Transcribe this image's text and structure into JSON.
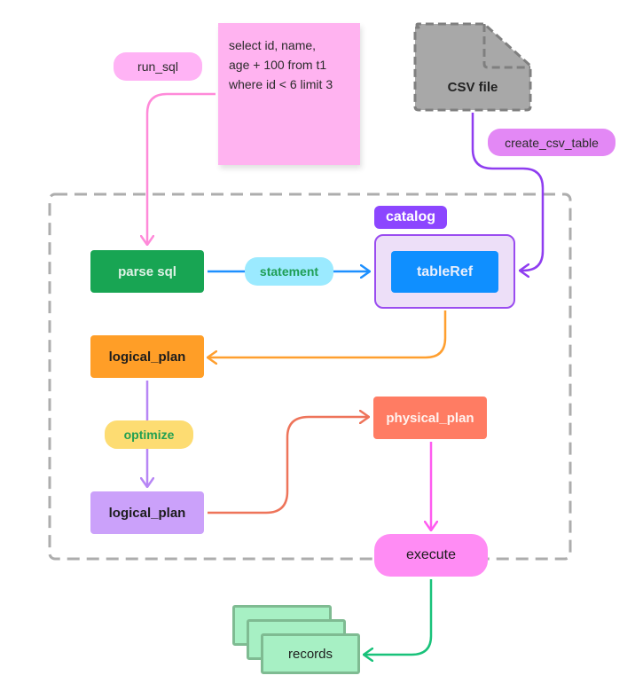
{
  "colors": {
    "frame_dash": "#adadad",
    "run_sql_pill": "#ffb3f5",
    "sticky_note": "#ffb3f0",
    "csv_fill": "#a8a8a8",
    "csv_stroke": "#7f7f7f",
    "create_csv_pill": "#e388f5",
    "catalog_badge": "#8c46ff",
    "catalog_box_fill": "#eddff8",
    "catalog_box_stroke": "#9a4cf0",
    "table_ref": "#0f8fff",
    "parse_sql": "#18a553",
    "statement_pill": "#9beaff",
    "statement_text": "#1f9e55",
    "logical_plan_1": "#ff9e27",
    "optimize_pill": "#fddc72",
    "optimize_text": "#23a052",
    "logical_plan_2": "#cba1fa",
    "physical_plan": "#ff7c63",
    "execute": "#ff8cf4",
    "records_fill": "#a7f0c4",
    "records_stroke": "#7fbb92",
    "arrow_pink": "#ff8ad9",
    "arrow_purple": "#8f3df0",
    "arrow_blue": "#1e90ff",
    "arrow_orange": "#ff9f2f",
    "arrow_lavender": "#b786f5",
    "arrow_coral": "#ee745a",
    "arrow_magenta": "#ff5cf0",
    "arrow_green": "#19c27a"
  },
  "labels": {
    "run_sql": "run_sql",
    "sql_lines": [
      "select id, name,",
      "age + 100 from t1",
      "where id < 6 limit 3"
    ],
    "csv_file": "CSV file",
    "create_csv_table": "create_csv_table",
    "catalog": "catalog",
    "table_ref": "tableRef",
    "parse_sql": "parse sql",
    "statement": "statement",
    "logical_plan_1": "logical_plan",
    "optimize": "optimize",
    "logical_plan_2": "logical_plan",
    "physical_plan": "physical_plan",
    "execute": "execute",
    "records": "records"
  }
}
